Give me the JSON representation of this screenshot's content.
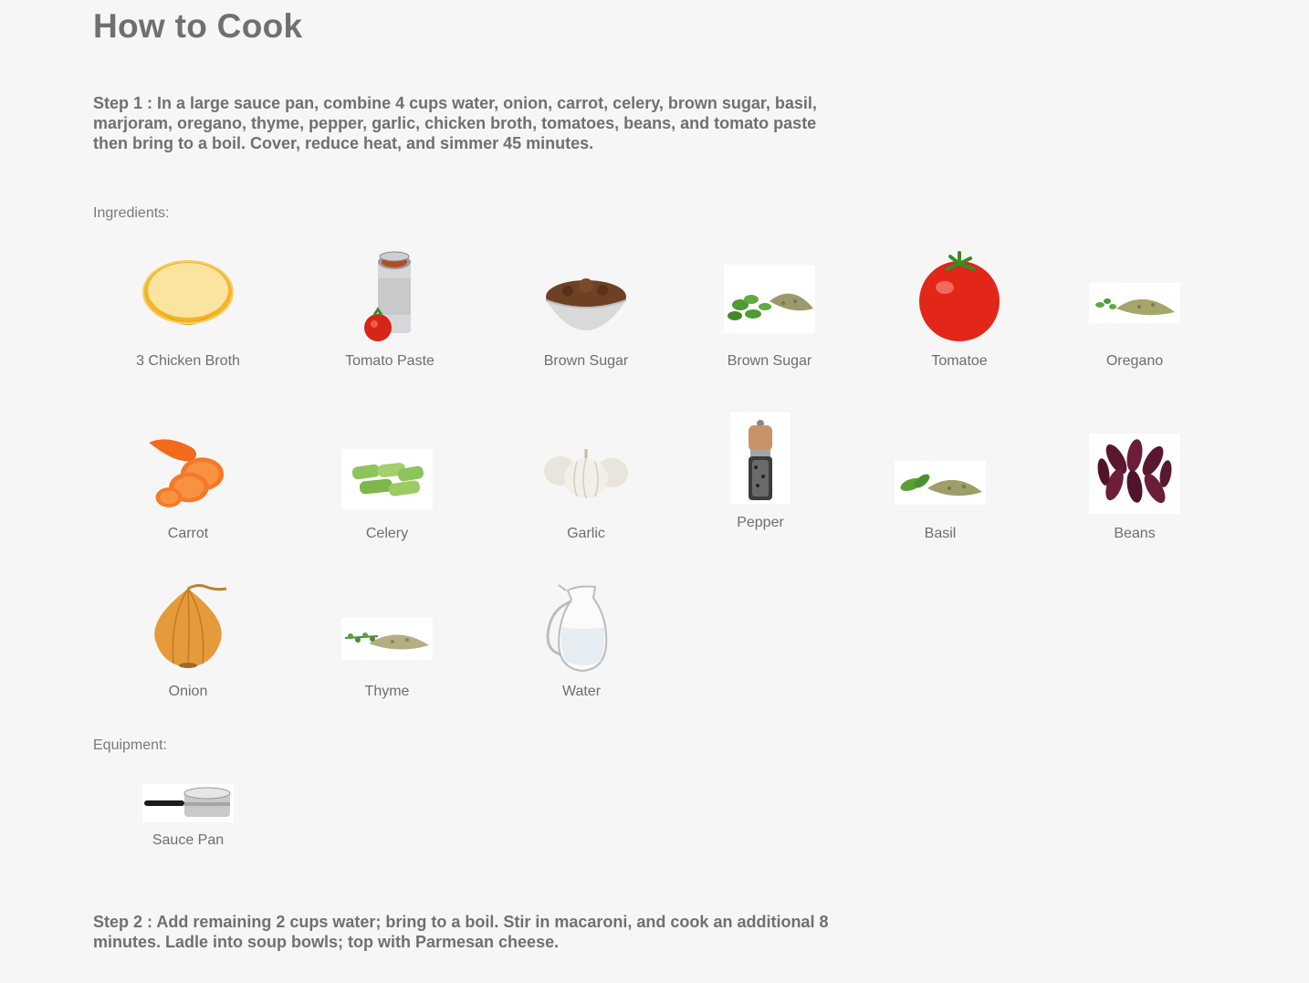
{
  "page": {
    "title": "How to Cook"
  },
  "steps": [
    "Step 1 : In a large sauce pan, combine 4 cups water, onion, carrot, celery, brown sugar, basil, marjoram, oregano, thyme, pepper, garlic, chicken broth, tomatoes, beans, and tomato paste then bring to a boil. Cover, reduce heat, and simmer 45 minutes.",
    "Step 2 : Add remaining 2 cups water; bring to a boil. Stir in macaroni, and cook an additional 8 minutes. Ladle into soup bowls; top with Parmesan cheese."
  ],
  "sections": {
    "ingredients_label": "Ingredients:",
    "equipment_label": "Equipment:"
  },
  "ingredients": [
    {
      "name": "3 Chicken Broth",
      "icon": "broth-bowl-icon"
    },
    {
      "name": "Tomato Paste",
      "icon": "tomato-can-icon"
    },
    {
      "name": "Brown Sugar",
      "icon": "brown-sugar-bowl-icon"
    },
    {
      "name": "Brown Sugar",
      "icon": "herb-leaves-icon"
    },
    {
      "name": "Tomatoe",
      "icon": "tomato-icon"
    },
    {
      "name": "Oregano",
      "icon": "oregano-icon"
    },
    {
      "name": "Carrot",
      "icon": "carrot-icon"
    },
    {
      "name": "Celery",
      "icon": "celery-icon"
    },
    {
      "name": "Garlic",
      "icon": "garlic-icon"
    },
    {
      "name": "Pepper",
      "icon": "pepper-grinder-icon"
    },
    {
      "name": "Basil",
      "icon": "basil-icon"
    },
    {
      "name": "Beans",
      "icon": "kidney-beans-icon"
    },
    {
      "name": "Onion",
      "icon": "onion-icon"
    },
    {
      "name": "Thyme",
      "icon": "thyme-icon"
    },
    {
      "name": "Water",
      "icon": "water-jug-icon"
    }
  ],
  "equipment": [
    {
      "name": "Sauce Pan",
      "icon": "sauce-pan-icon"
    }
  ]
}
